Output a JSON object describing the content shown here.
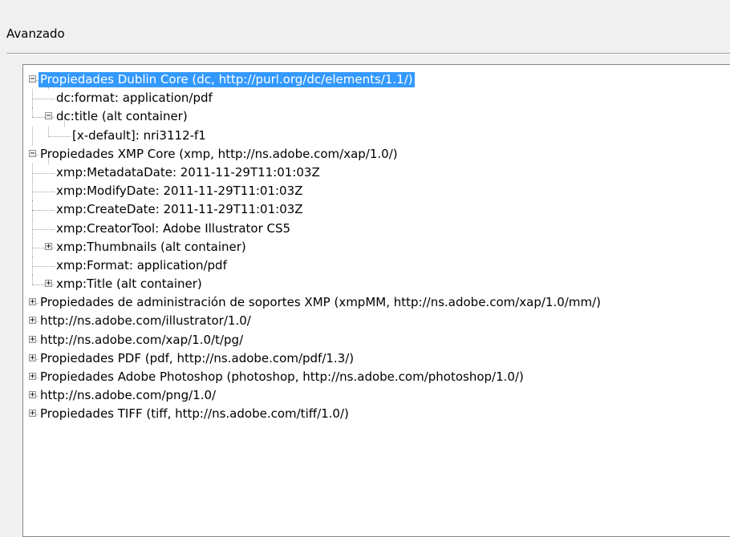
{
  "section": {
    "title": "Avanzado"
  },
  "tree": {
    "nodes": [
      {
        "label": "Propiedades Dublin Core (dc, http://purl.org/dc/elements/1.1/)",
        "depth": 0,
        "expander": "minus",
        "selected": true
      },
      {
        "label": "dc:format: application/pdf",
        "depth": 1,
        "expander": null
      },
      {
        "label": "dc:title (alt container)",
        "depth": 1,
        "expander": "minus"
      },
      {
        "label": "[x-default]: nri3112-f1",
        "depth": 2,
        "expander": null
      },
      {
        "label": "Propiedades XMP Core (xmp, http://ns.adobe.com/xap/1.0/)",
        "depth": 0,
        "expander": "minus"
      },
      {
        "label": "xmp:MetadataDate: 2011-11-29T11:01:03Z",
        "depth": 1,
        "expander": null
      },
      {
        "label": "xmp:ModifyDate: 2011-11-29T11:01:03Z",
        "depth": 1,
        "expander": null
      },
      {
        "label": "xmp:CreateDate: 2011-11-29T11:01:03Z",
        "depth": 1,
        "expander": null
      },
      {
        "label": "xmp:CreatorTool: Adobe Illustrator CS5",
        "depth": 1,
        "expander": null
      },
      {
        "label": "xmp:Thumbnails (alt container)",
        "depth": 1,
        "expander": "plus"
      },
      {
        "label": "xmp:Format: application/pdf",
        "depth": 1,
        "expander": null
      },
      {
        "label": "xmp:Title (alt container)",
        "depth": 1,
        "expander": "plus"
      },
      {
        "label": "Propiedades de administración de soportes XMP (xmpMM, http://ns.adobe.com/xap/1.0/mm/)",
        "depth": 0,
        "expander": "plus"
      },
      {
        "label": "http://ns.adobe.com/illustrator/1.0/",
        "depth": 0,
        "expander": "plus"
      },
      {
        "label": "http://ns.adobe.com/xap/1.0/t/pg/",
        "depth": 0,
        "expander": "plus"
      },
      {
        "label": "Propiedades PDF (pdf, http://ns.adobe.com/pdf/1.3/)",
        "depth": 0,
        "expander": "plus"
      },
      {
        "label": "Propiedades Adobe Photoshop (photoshop, http://ns.adobe.com/photoshop/1.0/)",
        "depth": 0,
        "expander": "plus"
      },
      {
        "label": "http://ns.adobe.com/png/1.0/",
        "depth": 0,
        "expander": "plus"
      },
      {
        "label": "Propiedades TIFF (tiff, http://ns.adobe.com/tiff/1.0/)",
        "depth": 0,
        "expander": "plus"
      }
    ]
  },
  "colors": {
    "selection": "#3399ff",
    "guide": "#a0a0a0"
  }
}
